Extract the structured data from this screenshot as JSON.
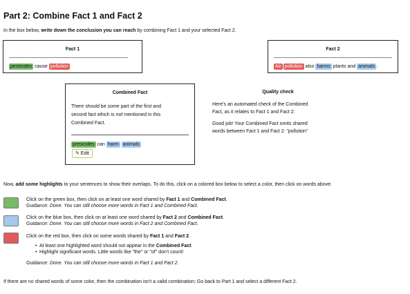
{
  "title": "Part 2: Combine Fact 1 and Fact 2",
  "intro": {
    "pre": "In the box below, ",
    "bold": "write down the conclusion you can reach",
    "post": " by combining Fact 1 and your selected Fact 2."
  },
  "fact1": {
    "title": "Fact 1",
    "words": [
      "pesticides",
      "cause",
      "pollution"
    ]
  },
  "fact2": {
    "title": "Fact 2",
    "words": [
      "Air",
      "pollution",
      "also",
      "harms",
      "plants",
      "and",
      "animals",
      "."
    ]
  },
  "combined": {
    "title": "Combined Fact",
    "instr_1": "There should be ",
    "instr_em1": "some",
    "instr_2": " part of the first and",
    "instr_3": "second fact which is ",
    "instr_em2": "not",
    "instr_4": " mentioned in this",
    "instr_5": "Combined Fact.",
    "words": [
      "presicides",
      "can",
      "harm",
      "animals"
    ],
    "edit_label": "✎ Edit"
  },
  "quality": {
    "title": "Quality check",
    "line1": "Here's an automated check of the Combined",
    "line2": "Fact, as it relates to Fact 1 and Fact 2:",
    "line3": "Good job! Your Combined Fact omits shared",
    "line4": "words between Fact 1 and Fact 2: \"pollution\""
  },
  "highlight_intro": {
    "pre": "Now, ",
    "bold": "add some highlights",
    "post": " to your sentences to show their overlaps. To do this, click on a colored box below to select a color, then click on words above."
  },
  "green": {
    "l1_pre": "Click on the green box, then click on at least one word shared by ",
    "l1_b1": "Fact 1",
    "l1_mid": " and ",
    "l1_b2": "Combined Fact",
    "l1_end": ".",
    "g_label": "Guidance:  ",
    "g_text": "Done. You can still choose more words in Fact 1 and Combined Fact."
  },
  "blue": {
    "l1_pre": "Click on the blue box, then click on at least one word shared by ",
    "l1_b1": "Fact 2",
    "l1_mid": " and ",
    "l1_b2": "Combined Fact",
    "l1_end": ".",
    "g_label": "Guidance:  ",
    "g_text": "Done. You can still choose more words in Fact 2 and Combined Fact."
  },
  "red": {
    "l1_pre": "Click on the red box, then click on some words shared by ",
    "l1_b1": "Fact 1",
    "l1_mid": " and ",
    "l1_b2": "Fact 2",
    "l1_end": ".",
    "bullet1_pre": "At least one highlighted word should not appear in the ",
    "bullet1_b": "Combined Fact",
    "bullet1_end": ".",
    "bullet2": "Highlight significant words. Little words like \"the\" or \"of\" don't count!",
    "g_label": "Guidance:  ",
    "g_text": "Done. You can still choose more words in Fact 1 and Fact 2."
  },
  "footer": "If there are no shared words of some color, then the combination isn't a valid combination; Go back to Part 1 and select a different Fact 2.",
  "colors": {
    "green": "#77bb66",
    "blue": "#a4c8ee",
    "red": "#e35a5a"
  }
}
